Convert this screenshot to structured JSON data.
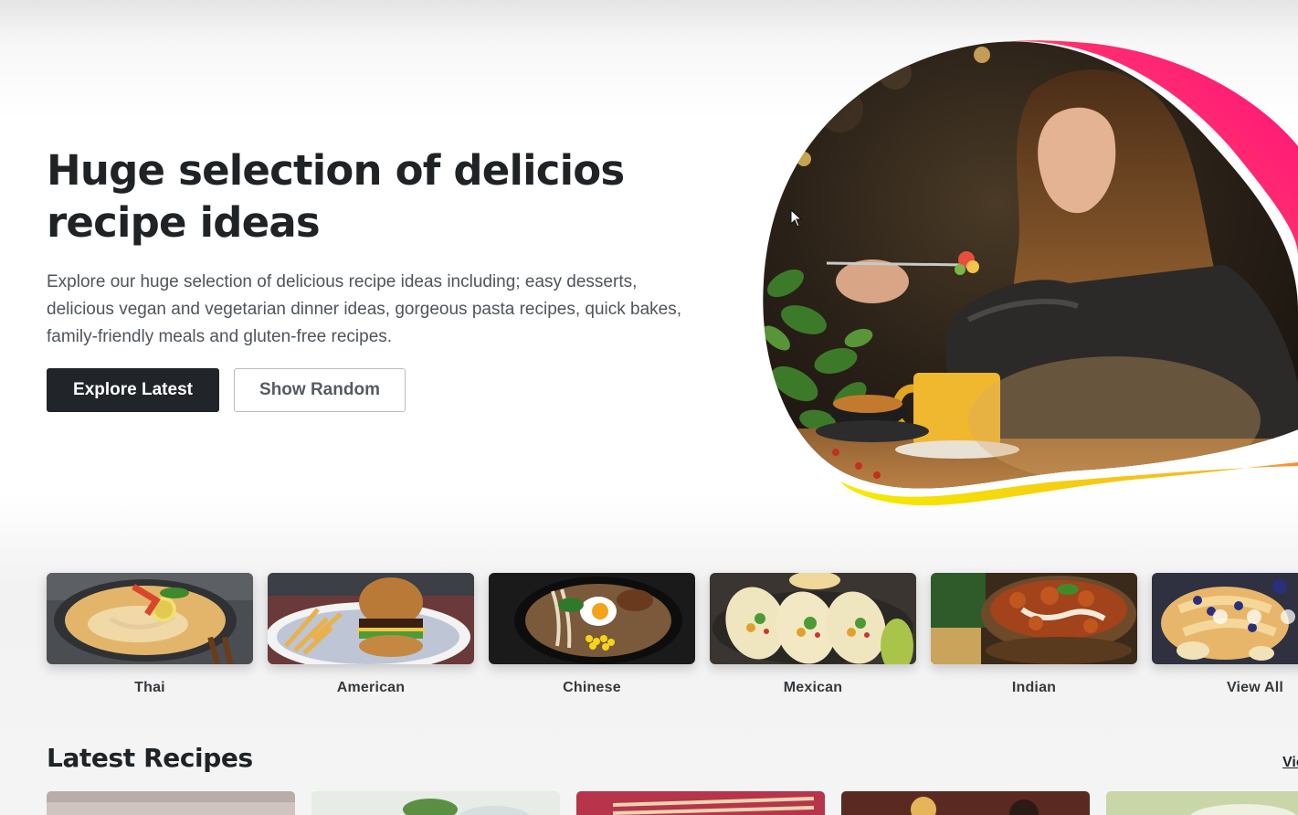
{
  "hero": {
    "title": "Huge selection of delicios recipe ideas",
    "description": "Explore our huge selection of delicious recipe ideas including; easy desserts, delicious vegan and vegetarian dinner ideas, gorgeous pasta recipes, quick bakes, family-friendly meals and gluten-free recipes.",
    "primary_button": "Explore Latest",
    "secondary_button": "Show Random"
  },
  "categories": [
    {
      "label": "Thai"
    },
    {
      "label": "American"
    },
    {
      "label": "Chinese"
    },
    {
      "label": "Mexican"
    },
    {
      "label": "Indian"
    },
    {
      "label": "View All"
    }
  ],
  "latest": {
    "heading": "Latest Recipes",
    "view_all": "View All"
  },
  "colors": {
    "primary": "#212529",
    "accent_pink": "#ff1f7a",
    "accent_yellow": "#f5f000"
  }
}
